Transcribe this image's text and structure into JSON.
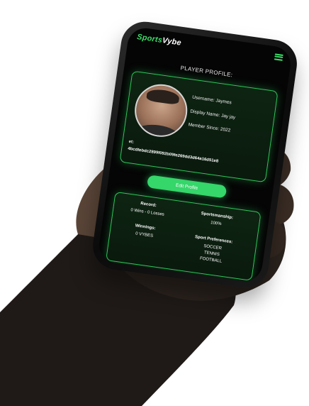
{
  "app": {
    "logo_part1": "Sports",
    "logo_part2": "Vybe"
  },
  "page": {
    "title": "PLAYER PROFILE:"
  },
  "profile": {
    "username": "Username: Jaymes",
    "display_name": "Display Name: Jay jay",
    "member_since": "Member Since: 2022",
    "wallet_label": "et:",
    "wallet_value": "4bcdfebdc2899f092b09fe269dd3d64a16d51e8"
  },
  "actions": {
    "edit_profile": "Edit Profile"
  },
  "stats": {
    "record_title": "Record:",
    "record_value": "0 Wins - 0 Losses",
    "winnings_title": "Winnings:",
    "winnings_value": "0 VYBES",
    "sportsmanship_title": "Sportsmanship:",
    "sportsmanship_value": "100%",
    "prefs_title": "Sport Preferences:",
    "prefs": [
      "SOCCER",
      "TENNIS",
      "FOOTBALL"
    ]
  },
  "colors": {
    "accent": "#35d66a",
    "card_border": "#2fc85b",
    "screen_bg": "#050505"
  },
  "icons": {
    "menu": "hamburger-menu-icon"
  }
}
